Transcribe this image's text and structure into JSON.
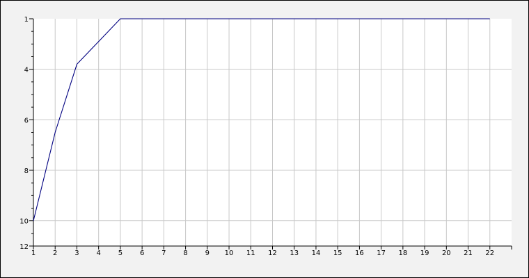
{
  "chart_data": {
    "type": "line",
    "title": "",
    "xlabel": "",
    "ylabel": "",
    "x": [
      1,
      2,
      3,
      4,
      5,
      6,
      7,
      8,
      9,
      10,
      11,
      12,
      13,
      14,
      15,
      16,
      17,
      18,
      19,
      20,
      21,
      22
    ],
    "series": [
      {
        "values": [
          11,
          7.5,
          4.8,
          3.9,
          3,
          3,
          3,
          3,
          3,
          3,
          3,
          3,
          3,
          3,
          3,
          3,
          3,
          3,
          3,
          3,
          3,
          3
        ],
        "color": "#000080"
      }
    ],
    "xlim": [
      1,
      23
    ],
    "ylim": [
      3,
      12
    ],
    "y_inverted": true,
    "x_ticks": [
      "1",
      "2",
      "3",
      "4",
      "5",
      "6",
      "7",
      "8",
      "9",
      "10",
      "11",
      "12",
      "13",
      "14",
      "15",
      "16",
      "17",
      "18",
      "19",
      "20",
      "21",
      "22"
    ],
    "y_ticks": [
      {
        "value": 3,
        "label": "1"
      },
      {
        "value": 5,
        "label": "4"
      },
      {
        "value": 7,
        "label": "6"
      },
      {
        "value": 9,
        "label": "8"
      },
      {
        "value": 11,
        "label": "10"
      },
      {
        "value": 12,
        "label": "12"
      }
    ],
    "y_minor_ticks": [
      3.5,
      4,
      4.5,
      5.5,
      6,
      6.5,
      7.5,
      8,
      8.5,
      9.5,
      10,
      10.5,
      11.5
    ],
    "grid": true,
    "legend": "none",
    "colors": {
      "background": "#f2f2f2",
      "plot_background": "#ffffff",
      "grid": "#c8c8c8",
      "axis": "#000000",
      "line": "#000080"
    }
  }
}
